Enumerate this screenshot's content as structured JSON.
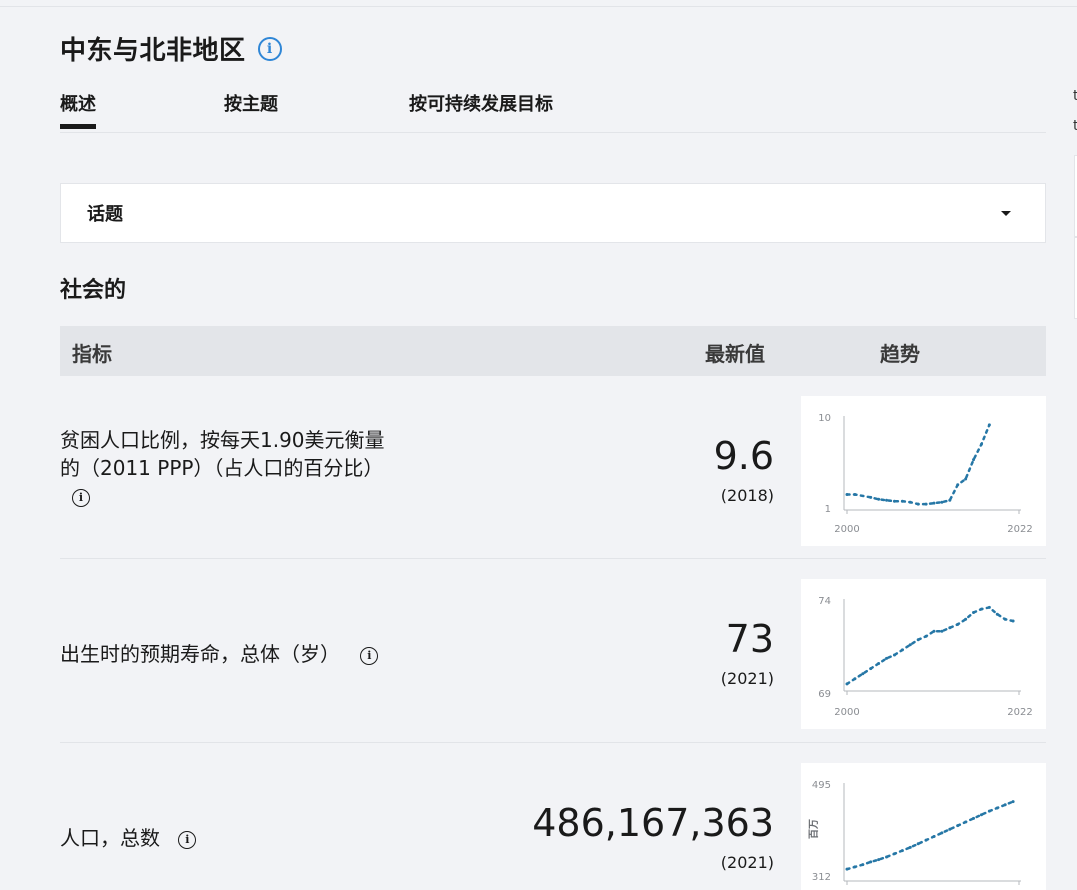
{
  "page": {
    "title": "中东与北非地区",
    "tabs": [
      "概述",
      "按主题",
      "按可持续发展目标"
    ],
    "dropdown_label": "话题",
    "section_title": "社会的"
  },
  "table": {
    "headers": {
      "indicator": "指标",
      "latest": "最新值",
      "trend": "趋势"
    },
    "rows": [
      {
        "indicator_line1": "贫困人口比例，按每天1.90美元衡量",
        "indicator_line2": "的（2011 PPP）（占人口的百分比）",
        "value": "9.6",
        "year": "(2018)"
      },
      {
        "indicator_line1": "出生时的预期寿命，总体（岁）",
        "value": "73",
        "year": "(2021)"
      },
      {
        "indicator_line1": "人口，总数",
        "value": "486,167,363",
        "year": "(2021)"
      }
    ]
  },
  "chart_data": [
    {
      "type": "line",
      "ylim": [
        1,
        10
      ],
      "xlim": [
        2000,
        2022
      ],
      "ytick_labels": [
        "10",
        "1"
      ],
      "xtick_labels": [
        "2000",
        "2022"
      ],
      "ylabel": "",
      "x": [
        2000,
        2001,
        2003,
        2004,
        2005,
        2006,
        2007,
        2008,
        2009,
        2010,
        2011,
        2012,
        2013,
        2014,
        2015,
        2016,
        2017,
        2018
      ],
      "y": [
        2.4,
        2.4,
        2.1,
        1.9,
        1.8,
        1.7,
        1.7,
        1.6,
        1.4,
        1.4,
        1.5,
        1.6,
        1.8,
        3.4,
        4.0,
        6.0,
        7.6,
        9.6
      ],
      "color": "#2677a6"
    },
    {
      "type": "line",
      "ylim": [
        69,
        74
      ],
      "xlim": [
        2000,
        2022
      ],
      "ytick_labels": [
        "74",
        "69"
      ],
      "xtick_labels": [
        "2000",
        "2022"
      ],
      "ylabel": "",
      "x": [
        2000,
        2001,
        2002,
        2003,
        2004,
        2005,
        2006,
        2007,
        2008,
        2009,
        2010,
        2011,
        2012,
        2013,
        2014,
        2015,
        2016,
        2017,
        2018,
        2019,
        2020,
        2021
      ],
      "y": [
        69.3,
        69.6,
        69.9,
        70.2,
        70.5,
        70.8,
        71.0,
        71.3,
        71.6,
        71.9,
        72.1,
        72.4,
        72.4,
        72.6,
        72.8,
        73.1,
        73.5,
        73.7,
        73.8,
        73.4,
        73.1,
        73.0
      ],
      "color": "#2677a6"
    },
    {
      "type": "line",
      "ylim": [
        312,
        495
      ],
      "xlim": [
        2000,
        2022
      ],
      "ytick_labels": [
        "495",
        "312"
      ],
      "xtick_labels": [],
      "ylabel": "百万",
      "x": [
        2000,
        2001,
        2002,
        2003,
        2004,
        2005,
        2006,
        2007,
        2008,
        2009,
        2010,
        2011,
        2012,
        2013,
        2014,
        2015,
        2016,
        2017,
        2018,
        2019,
        2020,
        2021
      ],
      "y": [
        316,
        321,
        326,
        332,
        337,
        343,
        350,
        357,
        364,
        372,
        380,
        388,
        396,
        404,
        412,
        420,
        428,
        436,
        444,
        451,
        458,
        465
      ],
      "color": "#2677a6"
    }
  ]
}
